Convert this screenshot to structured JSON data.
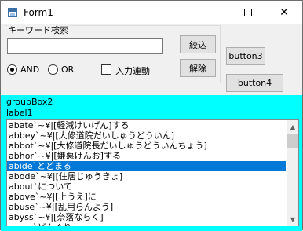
{
  "window": {
    "title": "Form1",
    "minimize_glyph": "",
    "maximize_glyph": "",
    "close_glyph": "✕"
  },
  "search_group": {
    "label": "キーワード検索",
    "input_value": "",
    "search_button": "絞込",
    "clear_button": "解除",
    "radio_and_label": "AND",
    "radio_or_label": "OR",
    "checkbox_label": "入力連動",
    "selected_mode": "AND"
  },
  "buttons": {
    "button3": "button3",
    "button4": "button4"
  },
  "group2": {
    "label": "groupBox2",
    "label1": "label1"
  },
  "list": {
    "selected_index": 4,
    "items": [
      "abate`~¥|[軽減けいげん]する",
      "abbey`~¥|[大修道院だいしゅうどういん]",
      "abbot`~¥|[大修道院長だいしゅうどういんちょう]",
      "abhor`~¥|[嫌悪けんお]する",
      "abide`とどまる",
      "abode`~¥|[住居じゅうきょ]",
      "about`について",
      "above`~¥|[上うえ]に",
      "abuse`~¥|[乱用らんよう]",
      "abyss`~¥|[奈落ならく]",
      "acorn`どんぐり"
    ]
  },
  "scrollbar": {
    "up_glyph": "▲",
    "down_glyph": "▼"
  }
}
